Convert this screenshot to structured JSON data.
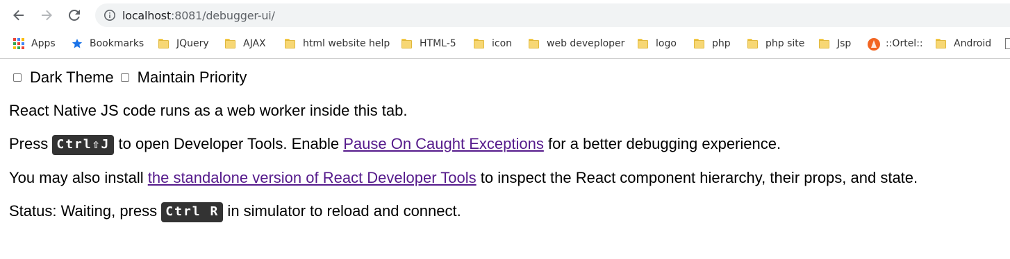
{
  "browser": {
    "url_host": "localhost",
    "url_rest": ":8081/debugger-ui/",
    "back_icon": "arrow-left-icon",
    "forward_icon": "arrow-right-icon",
    "reload_icon": "reload-icon",
    "info_icon": "info-icon"
  },
  "bookmarks": [
    {
      "label": "Apps",
      "icon": "apps-grid-icon"
    },
    {
      "label": "Bookmarks",
      "icon": "star-icon"
    },
    {
      "label": "JQuery",
      "icon": "folder-icon"
    },
    {
      "label": "AJAX",
      "icon": "folder-icon"
    },
    {
      "label": "html website help",
      "icon": "folder-icon"
    },
    {
      "label": "HTML-5",
      "icon": "folder-icon"
    },
    {
      "label": "icon",
      "icon": "folder-icon"
    },
    {
      "label": "web deveploper",
      "icon": "folder-icon"
    },
    {
      "label": "logo",
      "icon": "folder-icon"
    },
    {
      "label": "php",
      "icon": "folder-icon"
    },
    {
      "label": "php site",
      "icon": "folder-icon"
    },
    {
      "label": "Jsp",
      "icon": "folder-icon"
    },
    {
      "label": "::Ortel::",
      "icon": "ortel-icon"
    },
    {
      "label": "Android",
      "icon": "folder-icon"
    }
  ],
  "options": {
    "dark_theme": "Dark Theme",
    "maintain_priority": "Maintain Priority",
    "dark_theme_checked": false,
    "maintain_priority_checked": false
  },
  "content": {
    "line1": "React Native JS code runs as a web worker inside this tab.",
    "line2_prefix": "Press ",
    "line2_shortcut": "Ctrl⇧J",
    "line2_mid": " to open Developer Tools. Enable ",
    "line2_link": "Pause On Caught Exceptions",
    "line2_suffix": " for a better debugging experience.",
    "line3_prefix": "You may also install ",
    "line3_link": "the standalone version of React Developer Tools",
    "line3_suffix": " to inspect the React component hierarchy, their props, and state.",
    "line4_prefix": "Status: Waiting, press ",
    "line4_shortcut": "Ctrl R",
    "line4_suffix": " in simulator to reload and connect."
  },
  "colors": {
    "link": "#551a8b",
    "kbd_bg": "#333333",
    "folder": "#f7d774",
    "star": "#1a73e8"
  }
}
